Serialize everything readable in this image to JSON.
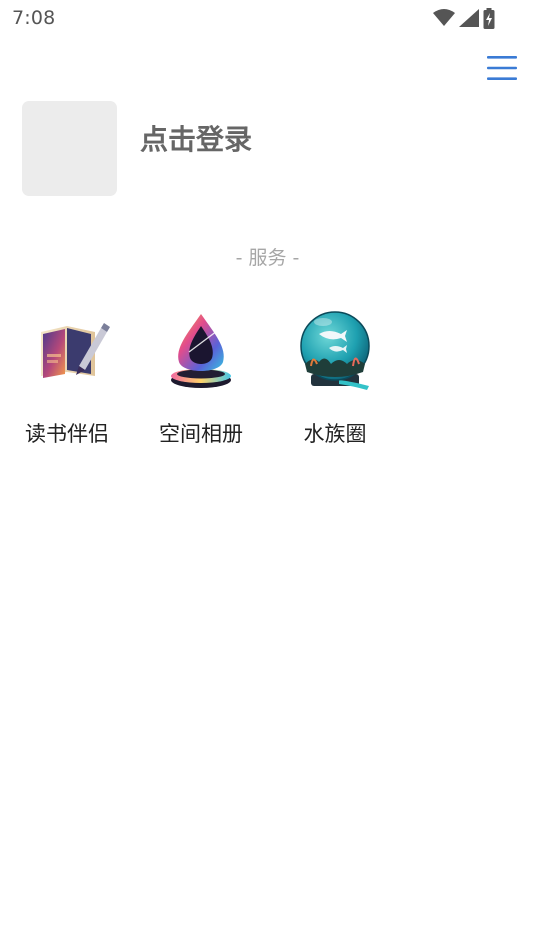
{
  "status_bar": {
    "time": "7:08"
  },
  "profile": {
    "login_label": "点击登录"
  },
  "services": {
    "title": "- 服务 -",
    "items": [
      {
        "label": "读书伴侣",
        "icon": "book-pen-icon"
      },
      {
        "label": "空间相册",
        "icon": "droplet-album-icon"
      },
      {
        "label": "水族圈",
        "icon": "aquarium-globe-icon"
      }
    ]
  },
  "colors": {
    "accent": "#3a7bd5",
    "avatar_bg": "#ececec",
    "muted_text": "#a6a6a6"
  }
}
